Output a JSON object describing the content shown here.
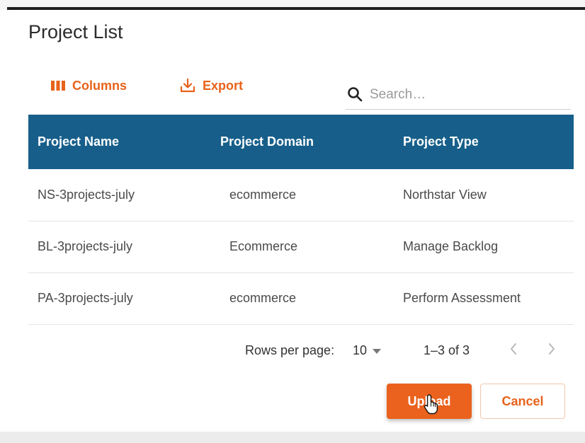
{
  "dialog": {
    "title": "Project List"
  },
  "toolbar": {
    "columns_label": "Columns",
    "export_label": "Export",
    "search_placeholder": "Search…",
    "search_value": ""
  },
  "table": {
    "headers": [
      "Project Name",
      "Project Domain",
      "Project Type"
    ],
    "rows": [
      {
        "name": "NS-3projects-july",
        "domain": "ecommerce",
        "type": "Northstar View"
      },
      {
        "name": "BL-3projects-july",
        "domain": "Ecommerce",
        "type": "Manage Backlog"
      },
      {
        "name": "PA-3projects-july",
        "domain": "ecommerce",
        "type": "Perform Assessment"
      }
    ]
  },
  "pagination": {
    "rows_per_page_label": "Rows per page:",
    "rows_per_page_value": "10",
    "range_label": "1–3 of 3"
  },
  "actions": {
    "upload_label": "Upload",
    "cancel_label": "Cancel"
  },
  "colors": {
    "accent": "#e8621a",
    "header_bg": "#175f8a"
  },
  "icons": {
    "columns": "columns-icon",
    "export": "download-icon",
    "search": "search-icon",
    "dropdown": "caret-down-icon",
    "prev": "chevron-left-icon",
    "next": "chevron-right-icon",
    "cursor": "hand-pointer-icon"
  }
}
